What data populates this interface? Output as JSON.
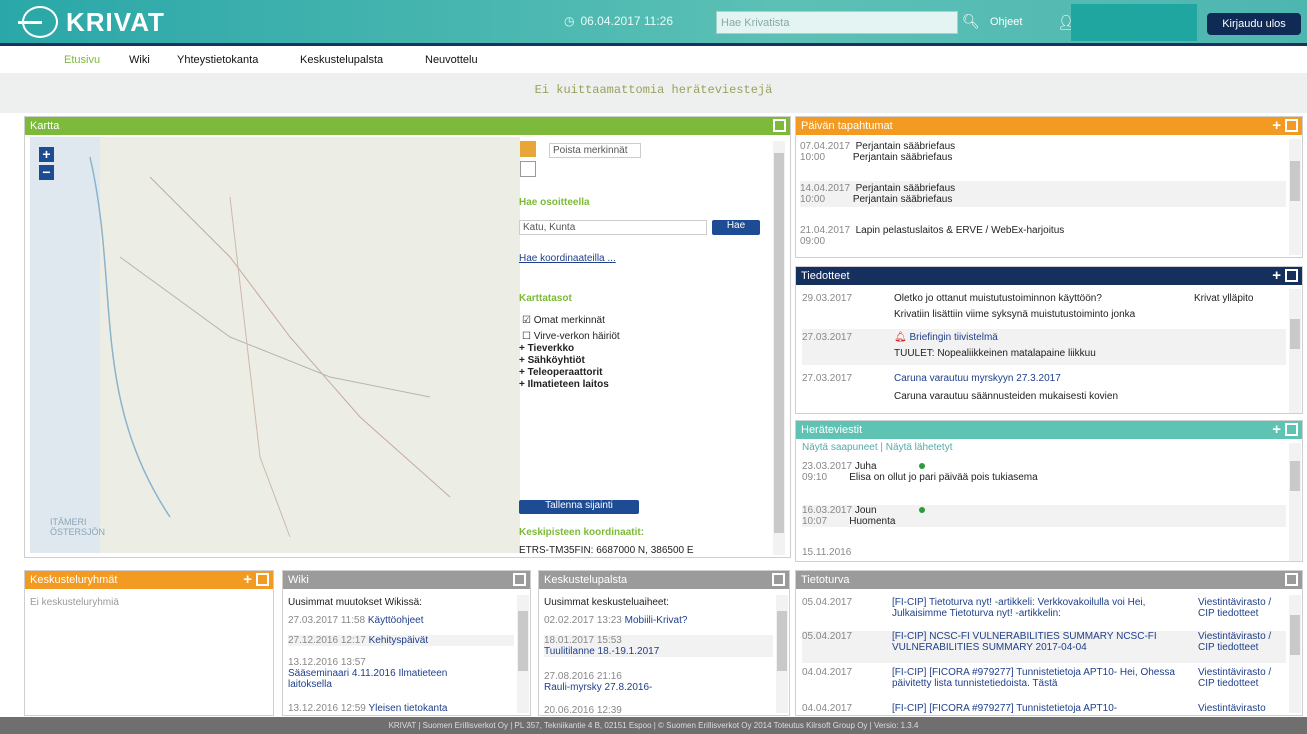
{
  "header": {
    "logo": "KRIVAT",
    "datetime": "06.04.2017 11:26",
    "search_placeholder": "Hae Krivatista",
    "channels": "Ohjeet",
    "logout": "Kirjaudu ulos"
  },
  "nav": [
    "Etusivu",
    "Wiki",
    "Yhteystietokanta",
    "Keskustelupalsta",
    "Neuvottelu"
  ],
  "notice": "Ei kuittaamattomia heräteviestejä",
  "map": {
    "title": "Kartta",
    "remove_marks": "Poista merkinnät",
    "address_label": "Hae osoitteella",
    "address_value": "Katu, Kunta",
    "search_btn": "Hae",
    "coords_link": "Hae koordinaateilla ...",
    "layers_label": "Karttatasot",
    "layer1": "Omat merkinnät",
    "layer2": "Virve-verkon häiriöt",
    "layer3": "+ Tieverkko",
    "layer4": "+ Sähköyhtiöt",
    "layer5": "+ Teleoperaattorit",
    "layer6": "+ Ilmatieteen laitos",
    "save_btn": "Tallenna sijainti",
    "center_label": "Keskipisteen koordinaatit:",
    "center_value": "ETRS-TM35FIN: 6687000 N, 386500 E",
    "place1": "ITÄMERI ÖSTERSJÖN"
  },
  "events": {
    "title": "Päivän tapahtumat",
    "items": [
      {
        "date": "07.04.2017",
        "time": "10:00",
        "text": "Perjantain sääbriefaus"
      },
      {
        "date": "14.04.2017",
        "time": "10:00",
        "text": "Perjantain sääbriefaus"
      },
      {
        "date": "21.04.2017",
        "time": "09:00",
        "text": "Lapin pelastuslaitos & ERVE / WebEx-harjoitus"
      }
    ]
  },
  "bulletins": {
    "title": "Tiedotteet",
    "items": [
      {
        "date": "29.03.2017",
        "title": "Oletko jo ottanut muistutustoiminnon käyttöön?",
        "body": "Krivatiin lisättiin viime syksynä muistutustoiminto jonka",
        "author": "Krivat ylläpito"
      },
      {
        "date": "27.03.2017",
        "title": "Briefingin tiivistelmä",
        "body": "TUULET: Nopealiikkeinen matalapaine liikkuu",
        "author": ""
      },
      {
        "date": "27.03.2017",
        "title": "Caruna varautuu myrskyyn 27.3.2017",
        "body": "Caruna varautuu säännusteiden mukaisesti kovien",
        "author": ""
      }
    ]
  },
  "alerts": {
    "title": "Heräteviestit",
    "tab1": "Näytä saapuneet",
    "tab2": "Näytä lähetetyt",
    "items": [
      {
        "date": "23.03.2017",
        "time": "09:10",
        "from": "Juha",
        "text": "Elisa on ollut jo pari päivää pois tukiasema"
      },
      {
        "date": "16.03.2017",
        "time": "10:07",
        "from": "Joun",
        "text": "Huomenta"
      },
      {
        "date": "15.11.2016",
        "time": "",
        "from": "",
        "text": ""
      }
    ]
  },
  "groups": {
    "title": "Keskusteluryhmät",
    "empty": "Ei keskusteluryhmiä"
  },
  "wiki": {
    "title": "Wiki",
    "intro": "Uusimmat muutokset Wikissä:",
    "items": [
      {
        "date": "27.03.2017 11:58",
        "text": "Käyttöohjeet"
      },
      {
        "date": "27.12.2016 12:17",
        "text": "Kehityspäivät"
      },
      {
        "date": "13.12.2016 13:57",
        "text": "Sääseminaari 4.11.2016 Ilmatieteen laitoksella"
      },
      {
        "date": "13.12.2016 12:59",
        "text": "Yleisen tietokanta"
      }
    ]
  },
  "forum": {
    "title": "Keskustelupalsta",
    "intro": "Uusimmat keskusteluaiheet:",
    "items": [
      {
        "date": "02.02.2017 13:23",
        "text": "Mobiili-Krivat?"
      },
      {
        "date": "18.01.2017 15:53",
        "text": "Tuulitilanne 18.-19.1.2017"
      },
      {
        "date": "27.08.2016 21:16",
        "text": "Rauli-myrsky 27.8.2016-"
      },
      {
        "date": "20.06.2016 12:39",
        "text": ""
      }
    ]
  },
  "security": {
    "title": "Tietoturva",
    "items": [
      {
        "date": "05.04.2017",
        "text": "[FI-CIP] Tietoturva nyt! -artikkeli: Verkkovakoilulla voi Hei, Julkaisimme Tietoturva nyt! -artikkelin:",
        "src": "Viestintävirasto / CIP tiedotteet"
      },
      {
        "date": "05.04.2017",
        "text": "[FI-CIP] NCSC-FI VULNERABILITIES SUMMARY NCSC-FI VULNERABILITIES SUMMARY 2017-04-04",
        "src": "Viestintävirasto / CIP tiedotteet"
      },
      {
        "date": "04.04.2017",
        "text": "[FI-CIP] [FICORA #979277] Tunnistetietoja APT10- Hei, Ohessa päivitetty lista tunnistetiedoista. Tästä",
        "src": "Viestintävirasto / CIP tiedotteet"
      },
      {
        "date": "04.04.2017",
        "text": "[FI-CIP] [FICORA #979277] Tunnistetietoja APT10-",
        "src": "Viestintävirasto"
      }
    ]
  },
  "footer": "KRIVAT | Suomen Erillisverkot Oy | PL 357, Tekniikantie 4 B, 02151 Espoo | © Suomen Erillisverkot Oy 2014 Toteutus Kilrsoft Group Oy | Versio: 1.3.4"
}
